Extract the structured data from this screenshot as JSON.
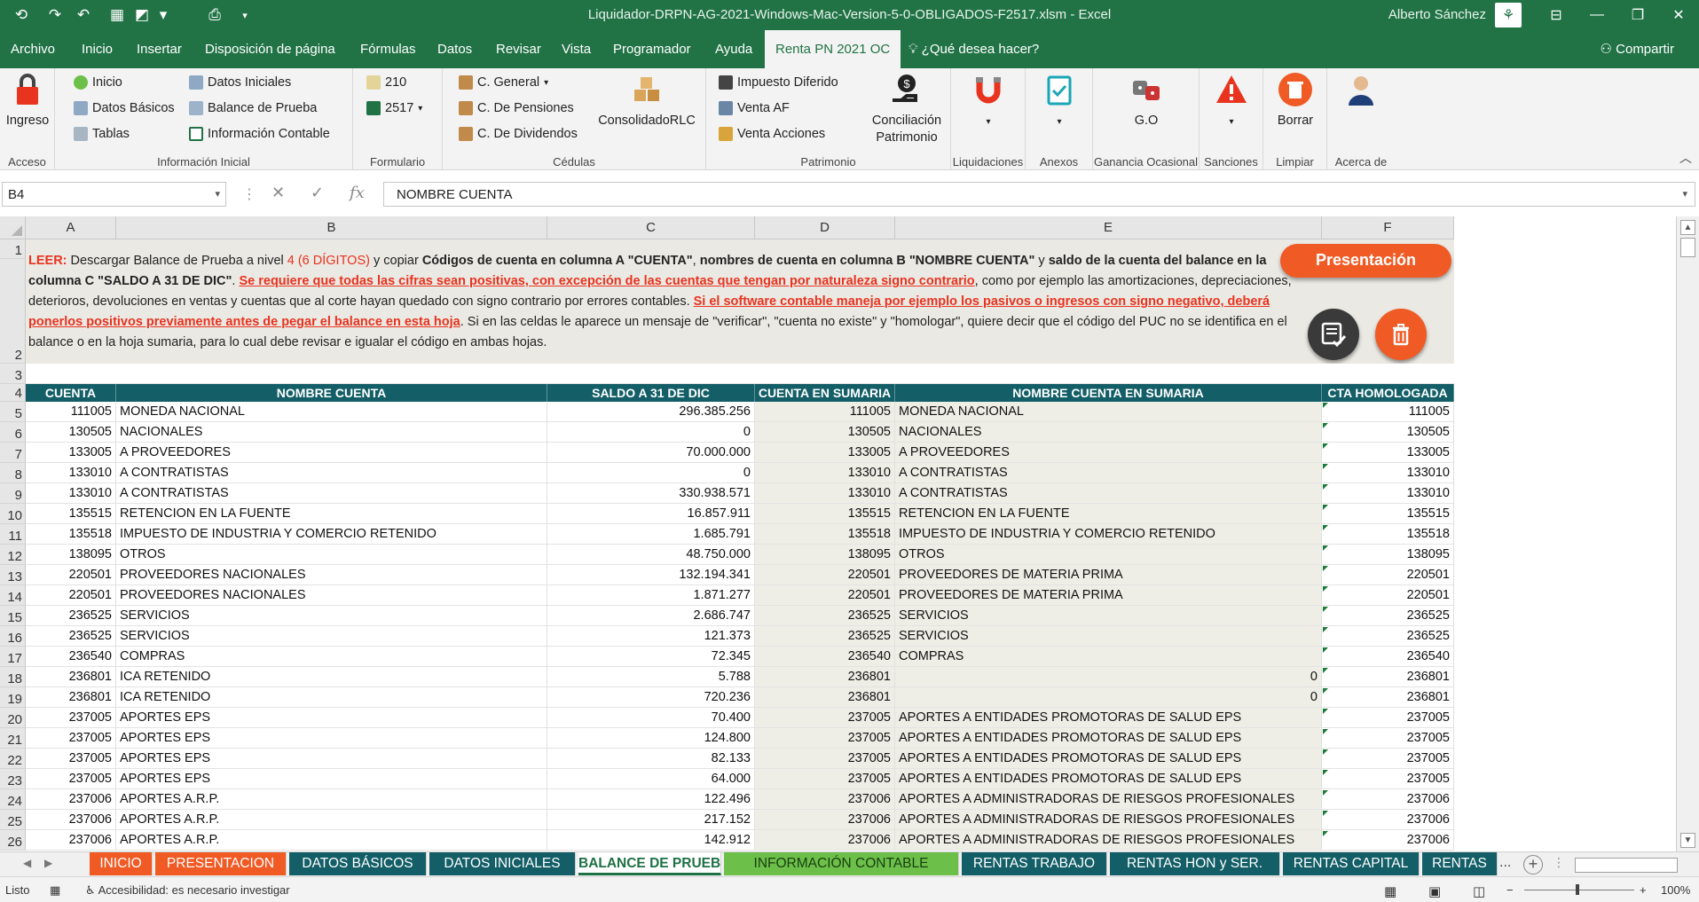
{
  "titlebar": {
    "title": "Liquidador-DRPN-AG-2021-Windows-Mac-Version-5-0-OBLIGADOS-F2517.xlsm  -  Excel",
    "user": "Alberto Sánchez"
  },
  "menu_tabs": [
    "Archivo",
    "Inicio",
    "Insertar",
    "Disposición de página",
    "Fórmulas",
    "Datos",
    "Revisar",
    "Vista",
    "Programador",
    "Ayuda",
    "Renta PN 2021 OC"
  ],
  "help_text": "¿Qué desea hacer?",
  "share_label": "Compartir",
  "ribbon": {
    "acceso": {
      "ingreso": "Ingreso",
      "label": "Acceso"
    },
    "info_inicial": {
      "inicio": "Inicio",
      "datos_basicos": "Datos Básicos",
      "tablas": "Tablas",
      "datos_iniciales": "Datos Iniciales",
      "balance": "Balance de Prueba",
      "info_contable": "Información Contable",
      "label": "Información Inicial"
    },
    "formulario": {
      "f210": "210",
      "f2517": "2517",
      "label": "Formulario"
    },
    "cedulas": {
      "general": "C. General",
      "pensiones": "C. De Pensiones",
      "dividendos": "C. De Dividendos",
      "consolidado": "ConsolidadoRLC",
      "label": "Cédulas"
    },
    "patrimonio": {
      "impuesto": "Impuesto Diferido",
      "venta_af": "Venta AF",
      "venta_acciones": "Venta Acciones",
      "conciliacion_1": "Conciliación",
      "conciliacion_2": "Patrimonio",
      "label": "Patrimonio"
    },
    "liquidaciones": "Liquidaciones",
    "anexos": "Anexos",
    "go": {
      "btn": "G.O",
      "label": "Ganancia Ocasional"
    },
    "sanciones": "Sanciones",
    "limpiar": {
      "btn": "Borrar",
      "label": "Limpiar"
    },
    "acerca": "Acerca de"
  },
  "formula_bar": {
    "cell_ref": "B4",
    "content": "NOMBRE CUENTA"
  },
  "columns": [
    "A",
    "B",
    "C",
    "D",
    "E",
    "F"
  ],
  "instructions": {
    "leer": "LEER:",
    "t1": " Descargar Balance de Prueba a nivel ",
    "nivel": "4 (6 DÍGITOS)",
    "t2": " y copiar ",
    "b1": "Códigos de cuenta en columna A \"CUENTA\"",
    "t3": ", ",
    "b2": "nombres de cuenta en columna B \"NOMBRE CUENTA\"",
    "t4": " y ",
    "b3": "saldo de la cuenta del balance en la columna C \"SALDO A 31 DE DIC\"",
    "t5": ". ",
    "r1": "Se requiere que todas las cifras sean positivas, con excepción de las cuentas que tengan por naturaleza signo contrario",
    "t6": ", como por ejemplo las amortizaciones, depreciaciones, deterioros, devoluciones en ventas y cuentas que al corte hayan quedado con signo contrario por errores contables. ",
    "r2": "Si el software contable maneja por ejemplo los pasivos o ingresos con signo negativo, deberá ponerlos positivos previamente antes de pegar el balance en esta hoja",
    "t7": ".  Si en las celdas le aparece un mensaje de \"verificar\", \"cuenta no existe\" y \"homologar\", quiere decir que el código del PUC no se identifica en el balance o en la hoja sumaria, para lo cual debe revisar e igualar el código en ambas hojas."
  },
  "presentacion_btn": "Presentación",
  "headers": [
    "CUENTA",
    "NOMBRE CUENTA",
    "SALDO A 31 DE DIC",
    "CUENTA EN SUMARIA",
    "NOMBRE CUENTA EN SUMARIA",
    "CTA HOMOLOGADA"
  ],
  "rows": [
    {
      "n": "5",
      "a": "111005",
      "b": "MONEDA NACIONAL",
      "c": "296.385.256",
      "d": "111005",
      "e": "MONEDA NACIONAL",
      "f": "111005"
    },
    {
      "n": "6",
      "a": "130505",
      "b": "NACIONALES",
      "c": "0",
      "d": "130505",
      "e": "NACIONALES",
      "f": "130505"
    },
    {
      "n": "7",
      "a": "133005",
      "b": "A PROVEEDORES",
      "c": "70.000.000",
      "d": "133005",
      "e": "A PROVEEDORES",
      "f": "133005"
    },
    {
      "n": "8",
      "a": "133010",
      "b": "A CONTRATISTAS",
      "c": "0",
      "d": "133010",
      "e": "A CONTRATISTAS",
      "f": "133010"
    },
    {
      "n": "9",
      "a": "133010",
      "b": "A CONTRATISTAS",
      "c": "330.938.571",
      "d": "133010",
      "e": "A CONTRATISTAS",
      "f": "133010"
    },
    {
      "n": "10",
      "a": "135515",
      "b": "RETENCION EN LA FUENTE",
      "c": "16.857.911",
      "d": "135515",
      "e": "RETENCION EN LA FUENTE",
      "f": "135515"
    },
    {
      "n": "11",
      "a": "135518",
      "b": "IMPUESTO DE INDUSTRIA Y COMERCIO RETENIDO",
      "c": "1.685.791",
      "d": "135518",
      "e": "IMPUESTO DE INDUSTRIA Y COMERCIO RETENIDO",
      "f": "135518"
    },
    {
      "n": "12",
      "a": "138095",
      "b": "OTROS",
      "c": "48.750.000",
      "d": "138095",
      "e": "OTROS",
      "f": "138095"
    },
    {
      "n": "13",
      "a": "220501",
      "b": "PROVEEDORES NACIONALES",
      "c": "132.194.341",
      "d": "220501",
      "e": "PROVEEDORES DE MATERIA PRIMA",
      "f": "220501"
    },
    {
      "n": "14",
      "a": "220501",
      "b": "PROVEEDORES NACIONALES",
      "c": "1.871.277",
      "d": "220501",
      "e": "PROVEEDORES DE MATERIA PRIMA",
      "f": "220501"
    },
    {
      "n": "15",
      "a": "236525",
      "b": "SERVICIOS",
      "c": "2.686.747",
      "d": "236525",
      "e": "SERVICIOS",
      "f": "236525"
    },
    {
      "n": "16",
      "a": "236525",
      "b": "SERVICIOS",
      "c": "121.373",
      "d": "236525",
      "e": "SERVICIOS",
      "f": "236525"
    },
    {
      "n": "17",
      "a": "236540",
      "b": "COMPRAS",
      "c": "72.345",
      "d": "236540",
      "e": "COMPRAS",
      "f": "236540"
    },
    {
      "n": "18",
      "a": "236801",
      "b": "ICA RETENIDO",
      "c": "5.788",
      "d": "236801",
      "e": "",
      "e_num": "0",
      "f": "236801"
    },
    {
      "n": "19",
      "a": "236801",
      "b": "ICA RETENIDO",
      "c": "720.236",
      "d": "236801",
      "e": "",
      "e_num": "0",
      "f": "236801"
    },
    {
      "n": "20",
      "a": "237005",
      "b": "APORTES EPS",
      "c": "70.400",
      "d": "237005",
      "e": "APORTES A ENTIDADES PROMOTORAS DE SALUD EPS",
      "f": "237005"
    },
    {
      "n": "21",
      "a": "237005",
      "b": "APORTES EPS",
      "c": "124.800",
      "d": "237005",
      "e": "APORTES A ENTIDADES PROMOTORAS DE SALUD EPS",
      "f": "237005"
    },
    {
      "n": "22",
      "a": "237005",
      "b": "APORTES EPS",
      "c": "82.133",
      "d": "237005",
      "e": "APORTES A ENTIDADES PROMOTORAS DE SALUD EPS",
      "f": "237005"
    },
    {
      "n": "23",
      "a": "237005",
      "b": "APORTES EPS",
      "c": "64.000",
      "d": "237005",
      "e": "APORTES A ENTIDADES PROMOTORAS DE SALUD EPS",
      "f": "237005"
    },
    {
      "n": "24",
      "a": "237006",
      "b": "APORTES  A.R.P.",
      "c": "122.496",
      "d": "237006",
      "e": "APORTES A ADMINISTRADORAS DE RIESGOS PROFESIONALES",
      "f": "237006"
    },
    {
      "n": "25",
      "a": "237006",
      "b": "APORTES  A.R.P.",
      "c": "217.152",
      "d": "237006",
      "e": "APORTES A ADMINISTRADORAS DE RIESGOS PROFESIONALES",
      "f": "237006"
    },
    {
      "n": "26",
      "a": "237006",
      "b": "APORTES  A.R.P.",
      "c": "142.912",
      "d": "237006",
      "e": "APORTES A ADMINISTRADORAS DE RIESGOS PROFESIONALES",
      "f": "237006"
    }
  ],
  "sheet_tabs": [
    {
      "label": "INICIO",
      "bg": "#f05a24",
      "fg": "#ffffff"
    },
    {
      "label": "PRESENTACION",
      "bg": "#f05a24",
      "fg": "#ffffff"
    },
    {
      "label": "DATOS BÁSICOS",
      "bg": "#135e67",
      "fg": "#ffffff"
    },
    {
      "label": "DATOS INICIALES",
      "bg": "#135e67",
      "fg": "#ffffff"
    },
    {
      "label": "BALANCE DE PRUEBA",
      "bg": "#ffffff",
      "fg": "#1e7145"
    },
    {
      "label": "INFORMACIÓN CONTABLE",
      "bg": "#6cc04a",
      "fg": "#1a3d10"
    },
    {
      "label": "RENTAS TRABAJO",
      "bg": "#135e67",
      "fg": "#ffffff"
    },
    {
      "label": "RENTAS HON y SER.",
      "bg": "#135e67",
      "fg": "#ffffff"
    },
    {
      "label": "RENTAS CAPITAL",
      "bg": "#135e67",
      "fg": "#ffffff"
    },
    {
      "label": "RENTAS",
      "bg": "#135e67",
      "fg": "#ffffff"
    }
  ],
  "sheet_more": "...",
  "status": {
    "mode": "Listo",
    "accessibility": "Accesibilidad: es necesario investigar",
    "zoom": "100%"
  },
  "colors": {
    "excel_green": "#217346",
    "header_teal": "#135e67",
    "accent_orange": "#f05a24",
    "instr_bg": "#ebe9e3",
    "shaded_col": "#efeee6"
  }
}
